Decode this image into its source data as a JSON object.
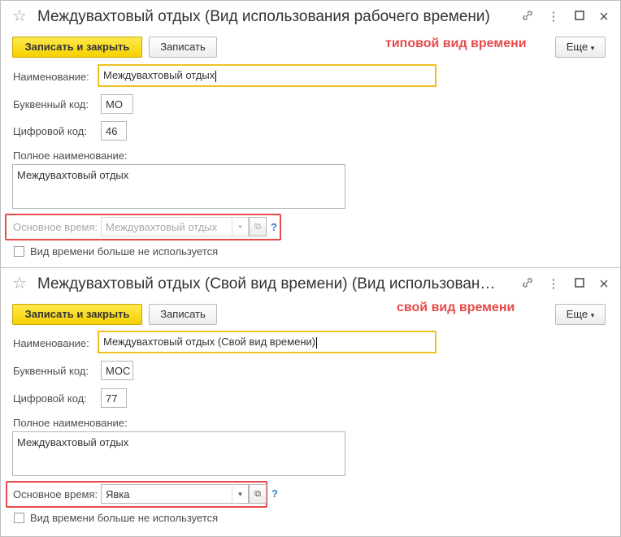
{
  "forms": [
    {
      "title": "Междувахтовый отдых (Вид использования рабочего времени)",
      "save_close_label": "Записать и закрыть",
      "save_label": "Записать",
      "annotation": "типовой вид времени",
      "more_label": "Еще",
      "name_label": "Наименование:",
      "name_value": "Междувахтовый отдых",
      "letter_code_label": "Буквенный код:",
      "letter_code_value": "МО",
      "digit_code_label": "Цифровой код:",
      "digit_code_value": "46",
      "full_name_label": "Полное наименование:",
      "full_name_value": "Междувахтовый отдых",
      "main_time_label": "Основное время:",
      "main_time_value": "Междувахтовый отдых",
      "main_time_disabled": true,
      "help_label": "?",
      "unused_label": "Вид времени больше не используется",
      "unused_checked": false
    },
    {
      "title": "Междувахтовый отдых (Свой вид времени) (Вид использовани...",
      "save_close_label": "Записать и закрыть",
      "save_label": "Записать",
      "annotation": "свой вид времени",
      "more_label": "Еще",
      "name_label": "Наименование:",
      "name_value": "Междувахтовый отдых (Свой вид времени)",
      "letter_code_label": "Буквенный код:",
      "letter_code_value": "МОС",
      "digit_code_label": "Цифровой код:",
      "digit_code_value": "77",
      "full_name_label": "Полное наименование:",
      "full_name_value": "Междувахтовый отдых",
      "main_time_label": "Основное время:",
      "main_time_value": "Явка",
      "main_time_disabled": false,
      "help_label": "?",
      "unused_label": "Вид времени больше не используется",
      "unused_checked": false
    }
  ],
  "icons": {
    "star": "☆",
    "link": "🔗",
    "more": "⋮",
    "maximize": "☐",
    "close": "×",
    "dropdown": "▾",
    "open": "⧉"
  },
  "colors": {
    "primary_button": "#f5d100",
    "focus_border": "#f0c020",
    "annotation": "#e84a4a",
    "help": "#3a7bd5"
  }
}
